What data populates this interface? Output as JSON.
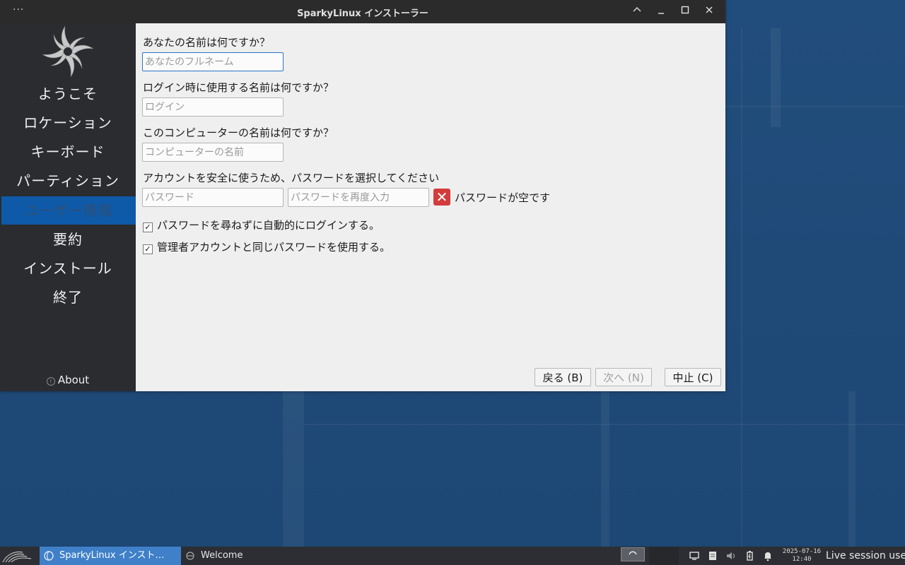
{
  "window": {
    "title": "SparkyLinux インストーラー",
    "menu_dots": "···"
  },
  "sidebar": {
    "items": [
      {
        "label": "ようこそ"
      },
      {
        "label": "ロケーション"
      },
      {
        "label": "キーボード"
      },
      {
        "label": "パーティション"
      },
      {
        "label": "ユーザー情報",
        "active": true
      },
      {
        "label": "要約"
      },
      {
        "label": "インストール"
      },
      {
        "label": "終了"
      }
    ],
    "about_label": "About"
  },
  "form": {
    "name_question": "あなたの名前は何ですか？",
    "name_placeholder": "あなたのフルネーム",
    "login_question": "ログイン時に使用する名前は何ですか？",
    "login_placeholder": "ログイン",
    "host_question": "このコンピューターの名前は何ですか？",
    "host_placeholder": "コンピューターの名前",
    "password_question": "アカウントを安全に使うため、パスワードを選択してください",
    "password_placeholder": "パスワード",
    "password_repeat_placeholder": "パスワードを再度入力",
    "password_error": "パスワードが空です",
    "autologin_label": "パスワードを尋ねずに自動的にログインする。",
    "autologin_checked": true,
    "same_password_label": "管理者アカウントと同じパスワードを使用する。",
    "same_password_checked": true
  },
  "buttons": {
    "back": "戻る (B)",
    "next": "次へ (N)",
    "cancel": "中止 (C)"
  },
  "taskbar": {
    "tasks": [
      {
        "label": "SparkyLinux インスト…",
        "active": true
      },
      {
        "label": "Welcome",
        "active": false
      }
    ],
    "clock_date": "2025-07-16",
    "clock_time": "12:40",
    "user": "Live session user"
  },
  "colors": {
    "accent": "#0e5aa8",
    "taskbar_active": "#3f80c8",
    "error": "#d23c3c",
    "desktop": "#1f4a78"
  }
}
